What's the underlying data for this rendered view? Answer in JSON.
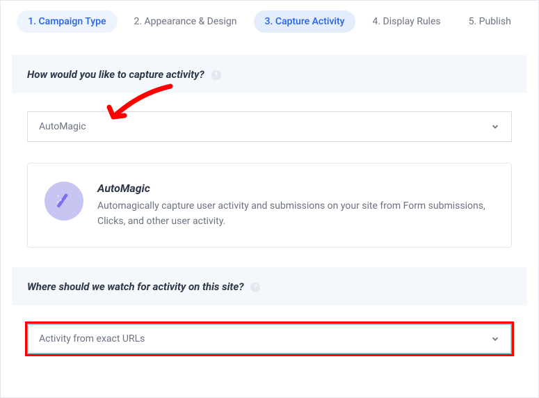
{
  "tabs": [
    {
      "label": "1. Campaign Type",
      "state": "pill"
    },
    {
      "label": "2. Appearance & Design",
      "state": "inactive"
    },
    {
      "label": "3. Capture Activity",
      "state": "active"
    },
    {
      "label": "4. Display Rules",
      "state": "inactive"
    },
    {
      "label": "5. Publish",
      "state": "inactive"
    }
  ],
  "section1": {
    "title": "How would you like to capture activity?",
    "select_value": "AutoMagic",
    "info_title": "AutoMagic",
    "info_desc": "Automagically capture user activity and submissions on your site from Form submissions, Clicks, and other user activity."
  },
  "section2": {
    "title": "Where should we watch for activity on this site?",
    "select_value": "Activity from exact URLs"
  }
}
